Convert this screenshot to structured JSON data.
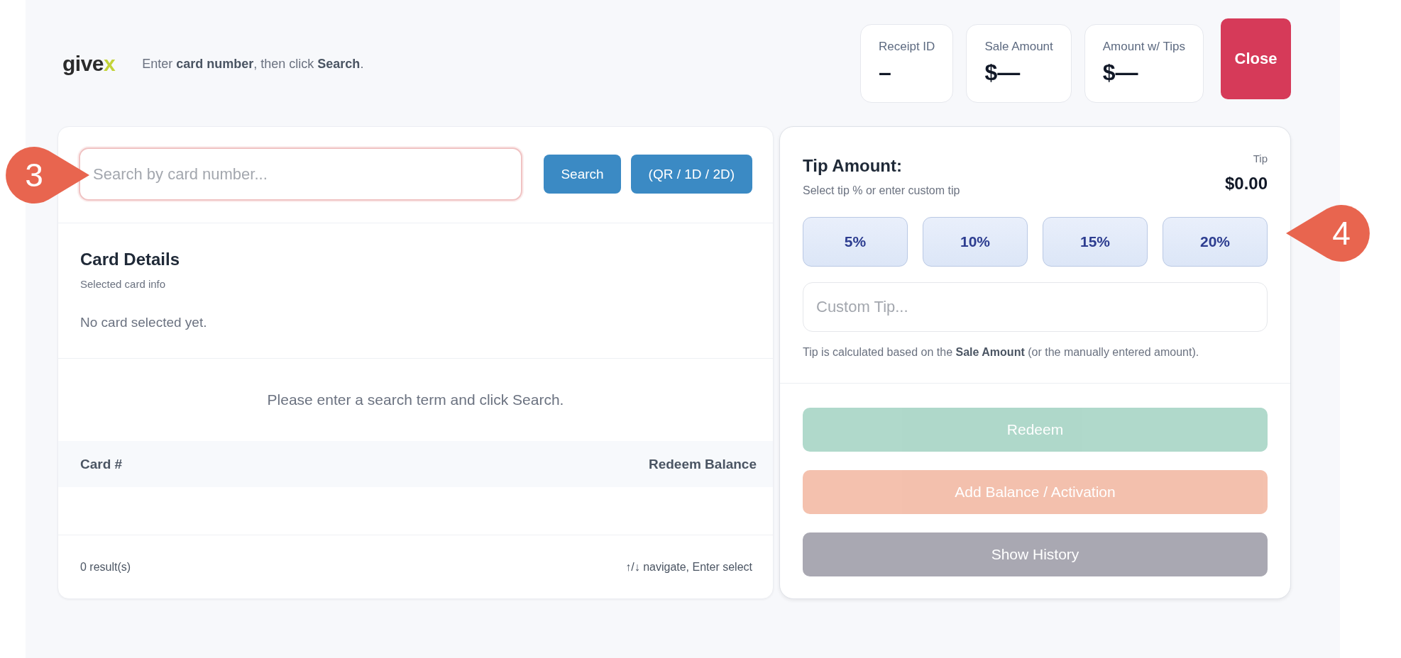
{
  "header": {
    "logo": {
      "text": "give",
      "accent": "x"
    },
    "hint": "Enter **card number**, then click **Search**.",
    "stats": [
      {
        "label": "Receipt ID",
        "value": "–"
      },
      {
        "label": "Sale Amount",
        "value": "$—"
      },
      {
        "label": "Amount w/ Tips",
        "value": "$—"
      }
    ],
    "close_button": "Close"
  },
  "search": {
    "placeholder": "Search by card number...",
    "focused": true,
    "callout": "3",
    "buttons": [
      "Search",
      "(QR / 1D / 2D)"
    ]
  },
  "card_details": {
    "title": "Card Details",
    "subtitle": "Selected card info",
    "empty_text": "No card selected yet."
  },
  "results": {
    "message": "Please enter a search term and click Search.",
    "columns": [
      "Card #",
      "Redeem Balance"
    ],
    "count": "0 result(s)",
    "keys_hint": "↑/↓ navigate, Enter select"
  },
  "tip": {
    "title": "Tip Amount:",
    "subtitle": "Select tip % or enter custom tip",
    "total_label": "Tip",
    "total": "$0.00",
    "callout": "4",
    "presets": [
      {
        "label": "5%",
        "selected": false
      },
      {
        "label": "10%",
        "selected": false
      },
      {
        "label": "15%",
        "selected": false
      },
      {
        "label": "20%",
        "selected": false
      }
    ],
    "custom_placeholder": "Custom Tip...",
    "note": "Tip is calculated based on the **Sale Amount** (or the manually entered amount)."
  },
  "actions": [
    {
      "label": "Redeem",
      "kind": "redeem",
      "disabled": true
    },
    {
      "label": "Add Balance / Activation",
      "kind": "activate",
      "disabled": true
    },
    {
      "label": "Show History",
      "kind": "history",
      "disabled": false
    }
  ]
}
